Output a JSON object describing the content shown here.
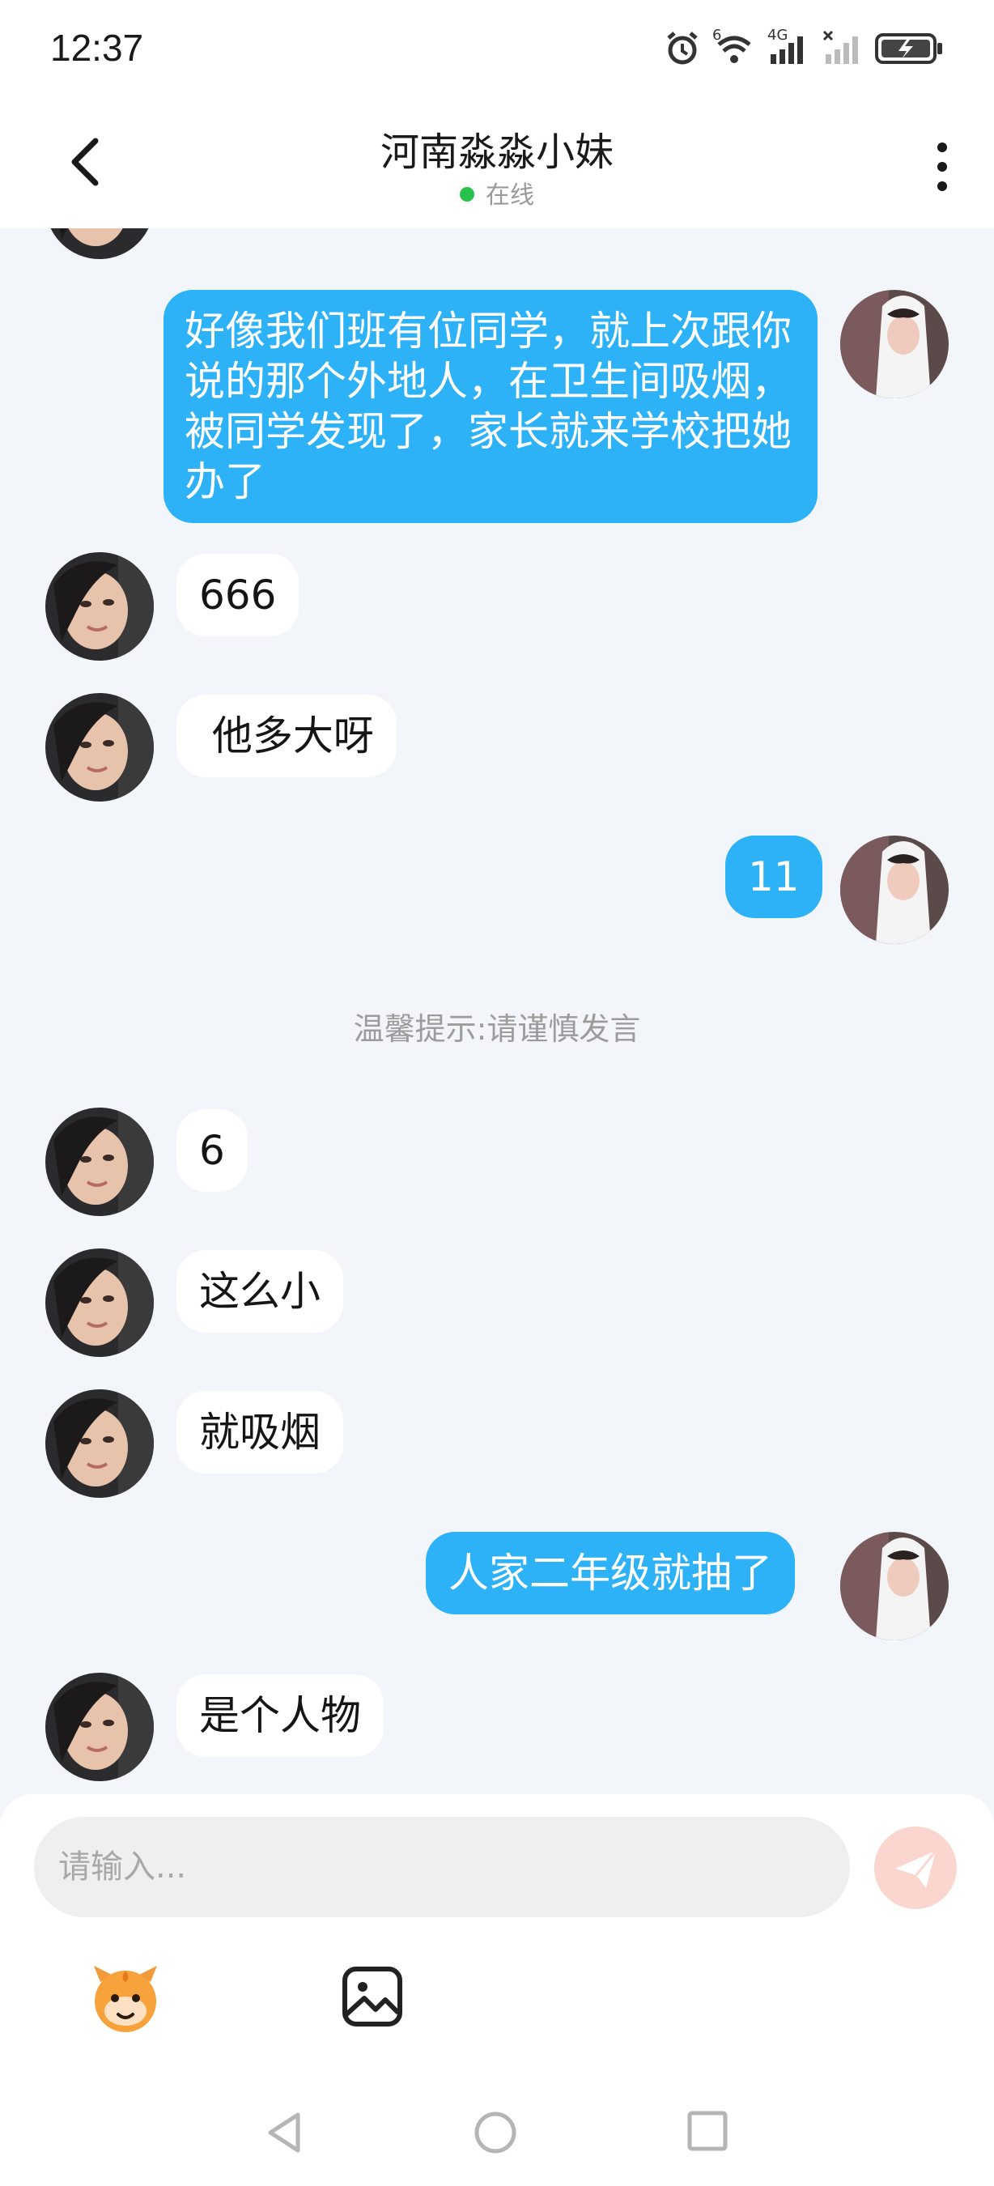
{
  "status_bar": {
    "time": "12:37",
    "network_label": "4G",
    "sim_label": "6",
    "icons": [
      "alarm-icon",
      "wifi-icon",
      "signal-icon",
      "signal-off-icon",
      "battery-icon"
    ]
  },
  "header": {
    "title": "河南淼淼小妹",
    "status": "在线",
    "back_icon": "chevron-left-icon",
    "more_icon": "more-vertical-icon"
  },
  "colors": {
    "out_bubble": "#2db2f7",
    "in_bubble": "#ffffff",
    "background": "#f2f5f9",
    "online": "#27c24c",
    "send_button": "#fbd6cf"
  },
  "messages": [
    {
      "side": "out",
      "text": "好像我们班有位同学，就上次跟你说的那个外地人，在卫生间吸烟，被同学发现了，家长就来学校把她办了"
    },
    {
      "side": "in",
      "text": "666"
    },
    {
      "side": "in",
      "text": " 他多大呀"
    },
    {
      "side": "out",
      "text": "11"
    },
    {
      "side": "in",
      "text": "6"
    },
    {
      "side": "in",
      "text": "这么小"
    },
    {
      "side": "in",
      "text": "就吸烟"
    },
    {
      "side": "out",
      "text": "人家二年级就抽了"
    },
    {
      "side": "in",
      "text": "是个人物"
    }
  ],
  "tip": "温馨提示:请谨慎发言",
  "composer": {
    "placeholder": "请输入...",
    "send_icon": "send-icon",
    "emoji_icon": "emoji-sticker-icon",
    "image_icon": "image-icon"
  },
  "nav_bar": {
    "icons": [
      "nav-back-icon",
      "nav-home-icon",
      "nav-recents-icon"
    ]
  }
}
